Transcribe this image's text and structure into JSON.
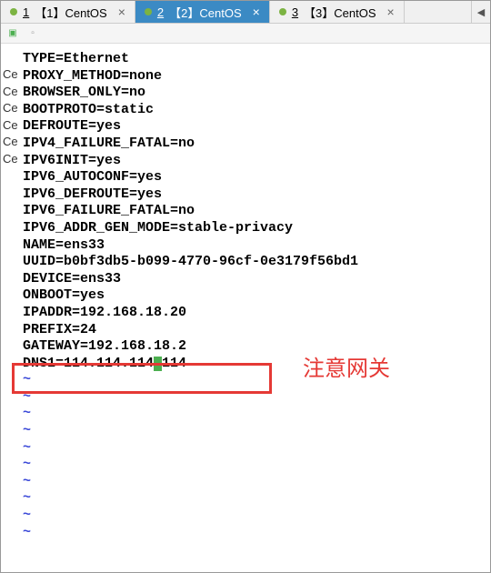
{
  "tabs": [
    {
      "num": "1",
      "label": "【1】CentOS",
      "active": false
    },
    {
      "num": "2",
      "label": "【2】CentOS",
      "active": true
    },
    {
      "num": "3",
      "label": "【3】CentOS",
      "active": false
    }
  ],
  "edge_label": "Ce",
  "config_lines": [
    "TYPE=Ethernet",
    "PROXY_METHOD=none",
    "BROWSER_ONLY=no",
    "BOOTPROTO=static",
    "DEFROUTE=yes",
    "IPV4_FAILURE_FATAL=no",
    "IPV6INIT=yes",
    "IPV6_AUTOCONF=yes",
    "IPV6_DEFROUTE=yes",
    "IPV6_FAILURE_FATAL=no",
    "IPV6_ADDR_GEN_MODE=stable-privacy",
    "NAME=ens33",
    "UUID=b0bf3db5-b099-4770-96cf-0e3179f56bd1",
    "DEVICE=ens33",
    "ONBOOT=yes",
    "IPADDR=192.168.18.20",
    "PREFIX=24",
    "GATEWAY=192.168.18.2"
  ],
  "cursor_line": {
    "before": "DNS1=114.114.114",
    "at": ".",
    "after": "114"
  },
  "tilde_count": 10,
  "annotation": "注意网关"
}
